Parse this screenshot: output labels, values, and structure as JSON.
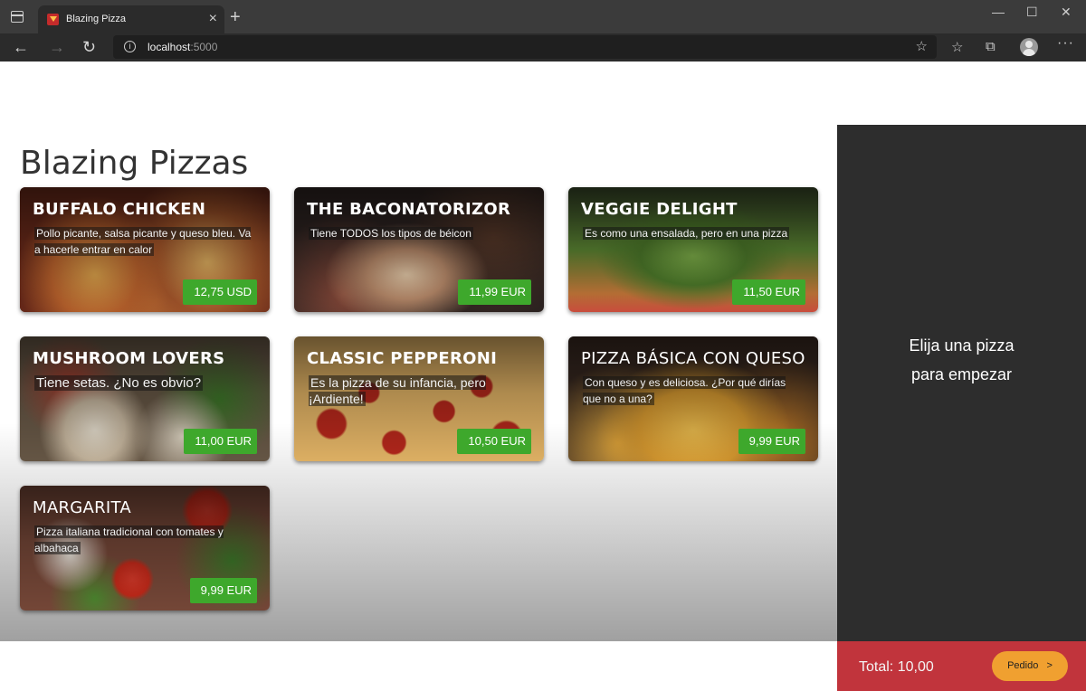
{
  "browser": {
    "tab_title": "Blazing Pizza",
    "address_host": "localhost",
    "address_port": ":5000"
  },
  "page": {
    "heading": "Blazing Pizzas"
  },
  "pizzas": [
    {
      "name": "BUFFALO CHICKEN",
      "description": "Pollo picante, salsa picante y queso bleu. Va a hacerle entrar en calor",
      "price": "12,75 USD"
    },
    {
      "name": "THE BACONATORIZOR",
      "description": "Tiene TODOS los tipos de béicon",
      "price": "11,99 EUR"
    },
    {
      "name": "VEGGIE DELIGHT",
      "description": "Es como una ensalada, pero en una pizza",
      "price": "11,50 EUR"
    },
    {
      "name": "MUSHROOM LOVERS",
      "description": "Tiene setas. ¿No es obvio?",
      "price": "11,00 EUR"
    },
    {
      "name": "CLASSIC PEPPERONI",
      "description": "Es la pizza de su infancia, pero ¡Ardiente!",
      "price": "10,50 EUR"
    },
    {
      "name": "PIZZA BÁSICA CON QUESO",
      "description": "Con queso y es deliciosa. ¿Por qué dirías que no a una?",
      "price": "9,99 EUR"
    },
    {
      "name": "MARGARITA",
      "description": "Pizza italiana tradicional con tomates y albahaca",
      "price": "9,99 EUR"
    }
  ],
  "sidebar": {
    "empty_line1": "Elija una pizza",
    "empty_line2": "para empezar",
    "total_label": "Total:",
    "total_value": "10,00",
    "order_button": "Pedido",
    "order_arrow": ">"
  }
}
